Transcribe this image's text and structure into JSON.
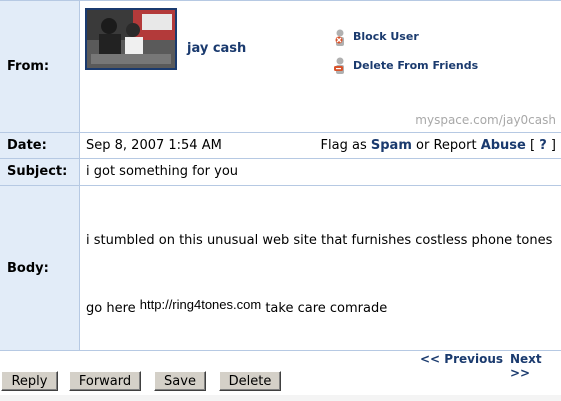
{
  "message": {
    "from_label": "From:",
    "date_label": "Date:",
    "subject_label": "Subject:",
    "body_label": "Body:",
    "sender_name": "jay cash",
    "sender_url": "myspace.com/jay0cash",
    "date": "Sep 8, 2007 1:54 AM",
    "subject": "i got something for you",
    "body_line1": "i stumbled on this unusual web site that furnishes costless phone tones",
    "body_line2_pre": "go here",
    "body_link": "http://ring4tones.com",
    "body_line2_post": "take care comrade"
  },
  "actions": {
    "block_user": "Block User",
    "delete_friend": "Delete From Friends"
  },
  "flag": {
    "prefix": "Flag as",
    "spam": "Spam",
    "middle": "or Report",
    "abuse": "Abuse",
    "open_bracket": "[",
    "help": "?",
    "close_bracket": "]"
  },
  "nav": {
    "previous": "<< Previous",
    "next": "Next >>"
  },
  "buttons": {
    "reply": "Reply",
    "forward": "Forward",
    "save": "Save",
    "delete": "Delete"
  },
  "colors": {
    "label_bg": "#e2ecf8",
    "link_blue": "#1a3a6e",
    "border": "#b6c9e3",
    "block_icon": "#d9532b"
  }
}
